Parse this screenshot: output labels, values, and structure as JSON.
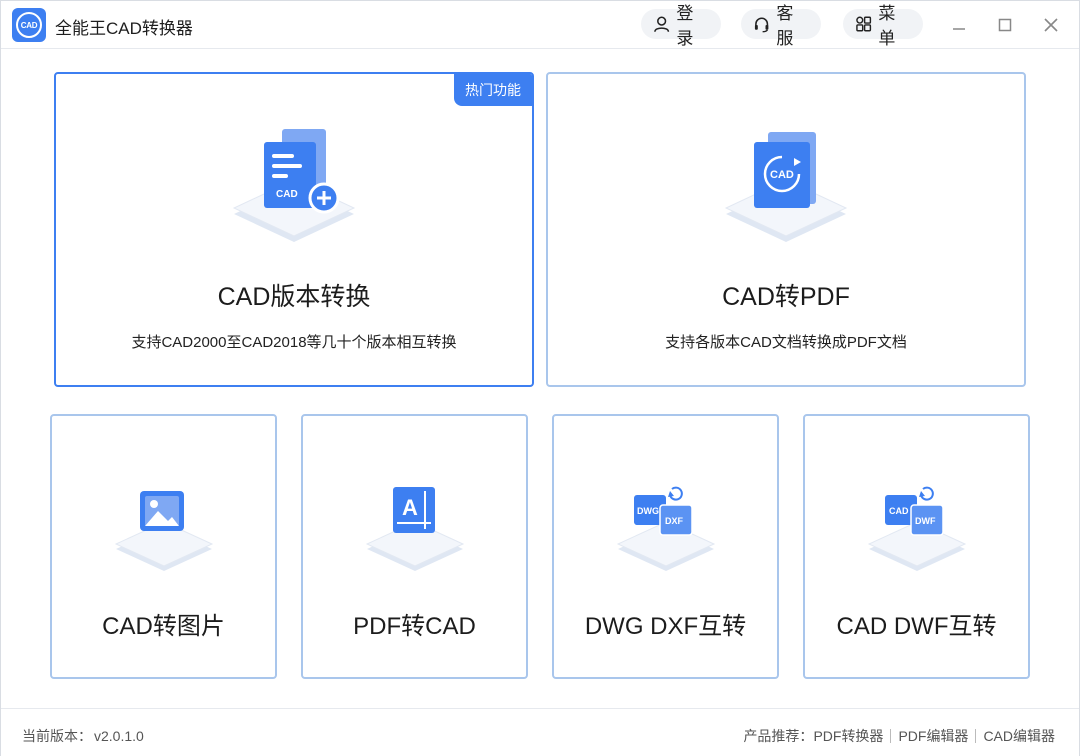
{
  "app": {
    "logo_text": "CAD",
    "title": "全能王CAD转换器"
  },
  "header": {
    "login_label": "登录",
    "service_label": "客服",
    "menu_label": "菜单"
  },
  "colors": {
    "accent": "#3d7ff1",
    "card_border": "#a9c6ec"
  },
  "features_main": [
    {
      "title": "CAD版本转换",
      "description": "支持CAD2000至CAD2018等几十个版本相互转换",
      "badge": "热门功能",
      "icon": "cad-add-icon",
      "icon_text": "CAD"
    },
    {
      "title": "CAD转PDF",
      "description": "支持各版本CAD文档转换成PDF文档",
      "icon": "cad-convert-icon",
      "icon_text": "CAD"
    }
  ],
  "features_secondary": [
    {
      "title": "CAD转图片",
      "icon": "image-icon"
    },
    {
      "title": "PDF转CAD",
      "icon": "text-a-icon",
      "icon_text": "A"
    },
    {
      "title": "DWG DXF互转",
      "icon": "dwg-dxf-icon",
      "icon_text_1": "DWG",
      "icon_text_2": "DXF"
    },
    {
      "title": "CAD DWF互转",
      "icon": "cad-dwf-icon",
      "icon_text_1": "CAD",
      "icon_text_2": "DWF"
    }
  ],
  "footer": {
    "version_label": "当前版本：",
    "version": "v2.0.1.0",
    "recommend_label": "产品推荐：",
    "links": [
      "PDF转换器",
      "PDF编辑器",
      "CAD编辑器"
    ]
  }
}
